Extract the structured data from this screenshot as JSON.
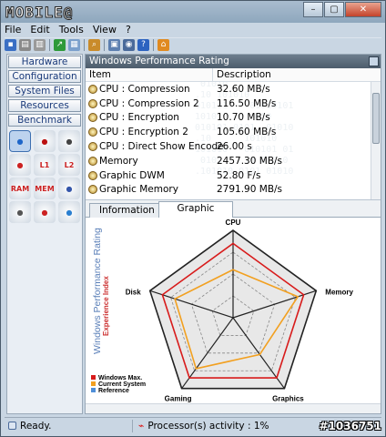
{
  "app": {
    "logo": "MOBILE",
    "logo_mark": "@"
  },
  "window_buttons": [
    "–",
    "▢",
    "✕"
  ],
  "menu": [
    "File",
    "Edit",
    "Tools",
    "View",
    "?"
  ],
  "toolbar_icons": [
    "save-icon",
    "print-icon",
    "print-preview-icon",
    "export-icon",
    "sheet-icon",
    "find-icon",
    "device-icon",
    "camera-icon",
    "help-icon",
    "home-icon"
  ],
  "nav": [
    "Hardware",
    "Configuration",
    "System Files",
    "Resources",
    "Benchmark"
  ],
  "nav_icons": [
    {
      "name": "performance-icon",
      "label": "",
      "color": "#1e66c9"
    },
    {
      "name": "cpu-gauge-icon",
      "label": "",
      "color": "#b11"
    },
    {
      "name": "disk-drive-icon",
      "label": "",
      "color": "#444"
    },
    {
      "name": "network-icon",
      "label": "",
      "color": "#c22"
    },
    {
      "name": "l1-cache-icon",
      "label": "L1",
      "color": "#c22"
    },
    {
      "name": "l2-cache-icon",
      "label": "L2",
      "color": "#c22"
    },
    {
      "name": "ram-icon",
      "label": "RAM",
      "color": "#c22"
    },
    {
      "name": "memory-icon",
      "label": "MEM",
      "color": "#c22"
    },
    {
      "name": "disk-check-icon",
      "label": "",
      "color": "#3355aa"
    },
    {
      "name": "cd-drive-icon",
      "label": "",
      "color": "#555"
    },
    {
      "name": "graphics-3d-icon",
      "label": "",
      "color": "#c22"
    },
    {
      "name": "settings-icon",
      "label": "",
      "color": "#2a7fd0"
    }
  ],
  "panel_title": "Windows Performance Rating",
  "table": {
    "headers": [
      "Item",
      "Description"
    ],
    "rows": [
      {
        "item": "CPU : Compression",
        "desc": "32.60 MB/s"
      },
      {
        "item": "CPU : Compression 2",
        "desc": "116.50 MB/s"
      },
      {
        "item": "CPU : Encryption",
        "desc": "10.70 MB/s"
      },
      {
        "item": "CPU : Encryption 2",
        "desc": "105.60 MB/s"
      },
      {
        "item": "CPU : Direct Show Encode",
        "desc": "26.00 s"
      },
      {
        "item": "Memory",
        "desc": "2457.30 MB/s"
      },
      {
        "item": "Graphic DWM",
        "desc": "52.80 F/s"
      },
      {
        "item": "Graphic Memory",
        "desc": "2791.90 MB/s"
      }
    ]
  },
  "tabs": [
    "Information",
    "Graphic"
  ],
  "radar": {
    "title": "Windows Performance Rating",
    "subtitle": "Experience Index",
    "axes": [
      "CPU",
      "Memory",
      "Graphics",
      "Gaming",
      "Disk"
    ],
    "legend": [
      {
        "name": "Windows Max.",
        "color": "#d81b1b"
      },
      {
        "name": "Current System",
        "color": "#f2a020"
      },
      {
        "name": "Reference",
        "color": "#4f8fd8"
      }
    ]
  },
  "chart_data": {
    "type": "radar",
    "title": "Windows Performance Rating",
    "subtitle": "Experience Index",
    "categories": [
      "CPU",
      "Memory",
      "Graphics",
      "Gaming",
      "Disk"
    ],
    "range": [
      0,
      1
    ],
    "series": [
      {
        "name": "Windows Max.",
        "values": [
          0.85,
          0.85,
          0.85,
          0.85,
          0.85
        ],
        "color": "#d81b1b"
      },
      {
        "name": "Current System",
        "values": [
          0.55,
          0.78,
          0.52,
          0.72,
          0.7
        ],
        "color": "#f2a020"
      },
      {
        "name": "Reference",
        "values": [
          0,
          0,
          0,
          0,
          0
        ],
        "color": "#4f8fd8"
      }
    ]
  },
  "status": {
    "ready": "Ready.",
    "activity_label": "Processor(s) activity : 1%"
  },
  "watermark_id": "#1036751"
}
